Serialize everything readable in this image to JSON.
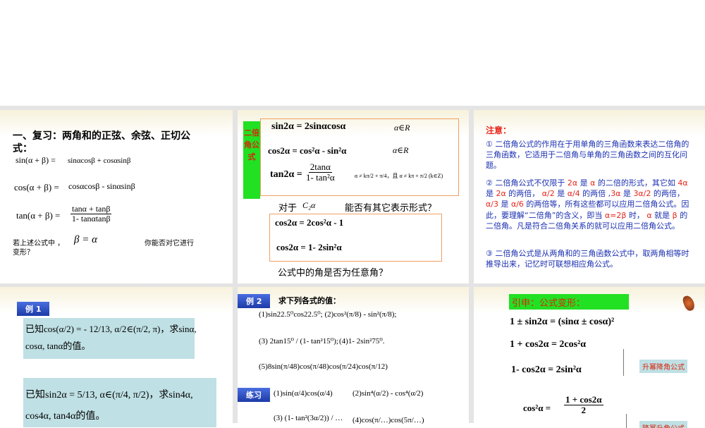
{
  "slides": [
    {
      "title": "一、复习：两角和的正弦、余弦、正切公式：",
      "sin_lhs": "sin(α + β) =",
      "sin_rhs": "sinαcosβ + cosαsinβ",
      "cos_lhs": "cos(α + β) =",
      "cos_rhs": "cosαcosβ - sinαsinβ",
      "tan_lhs": "tan(α + β) =",
      "tan_num": "tanα + tanβ",
      "tan_den": "1- tanαtanβ",
      "question_a": "若上述公式中 ，",
      "question_eq": "β = α",
      "question_b": "你能否对它进行",
      "question_c": "变形？"
    },
    {
      "side_label": "二倍角公式",
      "f1": "sin2α = 2sinαcosα",
      "f1_cond": "α∈R",
      "f2": "cos2α = cos²α - sin²α",
      "f2_cond": "α∈R",
      "f3_lhs": "tan2α =",
      "f3_num": "2tanα",
      "f3_den": "1- tan²α",
      "f3_cond": "α ≠ kπ/2 + π/4，且 α ≠ kπ + π/2 (k∈Z)",
      "q1_a": "对于",
      "q1_sym": "C₂α",
      "q1_b": "能否有其它表示形式？",
      "g1": "cos2α = 2cos²α - 1",
      "g2": "cos2α = 1- 2sin²α",
      "q2": "公式中的角是否为任意角？"
    },
    {
      "heading": "注意：",
      "p1": "① 二倍角公式的作用在于用单角的三角函数来表达二倍角的三角函数，它适用于二倍角与单角的三角函数之间的互化问题。",
      "p2": [
        "② 二倍角公式不仅限于 ",
        "2α",
        " 是 ",
        "α",
        " 的二倍的形式，其它如 ",
        "4α",
        " 是 ",
        "2α",
        " 的两倍， ",
        "α/2",
        " 是 ",
        "α/4",
        " 的两倍 ,",
        "3α",
        " 是 ",
        "3α/2",
        " 的两倍， ",
        "α/3",
        " 是 ",
        "α/6",
        " 的两倍等，所有这些都可以应用二倍角公式。因此，要理解“二倍角”的含义，即当 ",
        "α=2β",
        " 时， ",
        "α",
        " 就是 ",
        "β",
        " 的二倍角。凡是符合二倍角关系的就可以应用二倍角公式。"
      ],
      "p3": "③ 二倍角公式是从两角和的三角函数公式中，取两角相等时推导出来，记忆时可联想相应角公式。"
    },
    {
      "tag": "例 1",
      "ex1_a": "已知cos(α/2) = - 12/13, α/2∈(π/2, π)，求sinα,",
      "ex1_b": "cosα, tanα的值。",
      "ex2_a": "已知sin2α = 5/13, α∈(π/4, π/2)，求sin4α,",
      "ex2_b": "cos4α, tan4α的值。"
    },
    {
      "tag": "例 2",
      "title": "求下列各式的值：",
      "l1": "(1)sin22.5⁰cos22.5⁰;  (2)cos²(π/8) - sin²(π/8);",
      "l2a": "(3) 2tan15⁰ / (1- tan²15⁰);",
      "l2b": "(4)1- 2sin²75⁰.",
      "l3": "(5)8sin(π/48)cos(π/48)cos(π/24)cos(π/12)",
      "tag2": "练习",
      "p1": "(1)sin(α/4)cos(α/4)",
      "p2": "(2)sin⁴(α/2) - cos⁴(α/2)",
      "p3": "(3) (1- tan²(3α/2)) / …",
      "p4": "(4)cos(π/…)cos(5π/…)"
    },
    {
      "title": "引申：公式变形：",
      "e1": "1 ± sin2α = (sinα ± cosα)²",
      "e2": "1 + cos2α = 2cos²α",
      "e3": "1- cos2α = 2sin²α",
      "label1": "升幂降角公式",
      "e4_lhs": "cos²α =",
      "e4_num": "1 + cos2α",
      "e4_den": "2",
      "label2": "降幂升角公式"
    }
  ],
  "colors": {
    "red": "#e8261c",
    "blue": "#1a2fb0",
    "green": "#22e022",
    "box": "#bfe0e4"
  }
}
